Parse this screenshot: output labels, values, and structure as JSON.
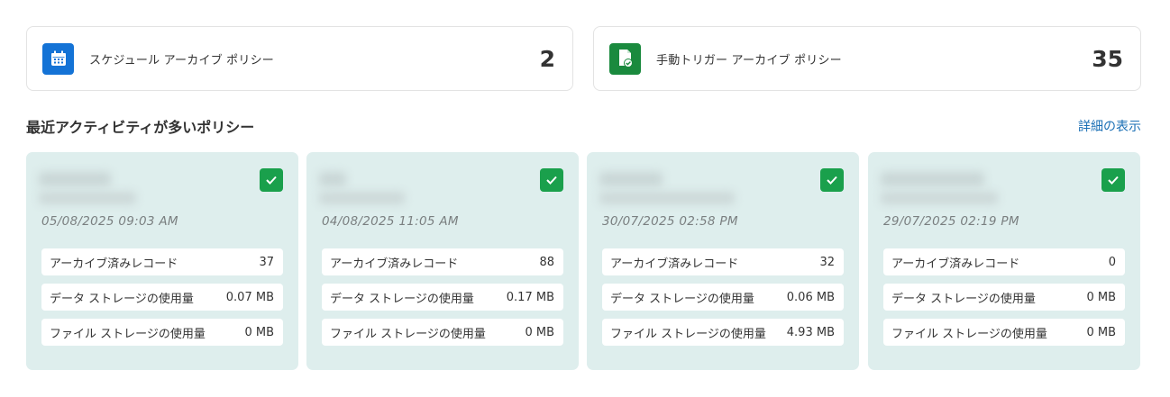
{
  "summary": [
    {
      "label": "スケジュール アーカイブ ポリシー",
      "count": "2",
      "icon": "calendar-icon",
      "color": "#1473d6"
    },
    {
      "label": "手動トリガー アーカイブ ポリシー",
      "count": "35",
      "icon": "document-check-icon",
      "color": "#1a8a3e"
    }
  ],
  "section": {
    "title": "最近アクティビティが多いポリシー",
    "details_link": "詳細の表示"
  },
  "policies": [
    {
      "date": "05/08/2025 09:03 AM",
      "metrics": [
        {
          "label": "アーカイブ済みレコード",
          "value": "37"
        },
        {
          "label": "データ ストレージの使用量",
          "value": "0.07 MB"
        },
        {
          "label": "ファイル ストレージの使用量",
          "value": "0 MB"
        }
      ]
    },
    {
      "date": "04/08/2025 11:05 AM",
      "metrics": [
        {
          "label": "アーカイブ済みレコード",
          "value": "88"
        },
        {
          "label": "データ ストレージの使用量",
          "value": "0.17 MB"
        },
        {
          "label": "ファイル ストレージの使用量",
          "value": "0 MB"
        }
      ]
    },
    {
      "date": "30/07/2025 02:58 PM",
      "metrics": [
        {
          "label": "アーカイブ済みレコード",
          "value": "32"
        },
        {
          "label": "データ ストレージの使用量",
          "value": "0.06 MB"
        },
        {
          "label": "ファイル ストレージの使用量",
          "value": "4.93 MB"
        }
      ]
    },
    {
      "date": "29/07/2025 02:19 PM",
      "metrics": [
        {
          "label": "アーカイブ済みレコード",
          "value": "0"
        },
        {
          "label": "データ ストレージの使用量",
          "value": "0 MB"
        },
        {
          "label": "ファイル ストレージの使用量",
          "value": "0 MB"
        }
      ]
    }
  ],
  "colors": {
    "card_bg": "#deeeed",
    "check": "#1aa04c",
    "link": "#1a6fb5"
  }
}
